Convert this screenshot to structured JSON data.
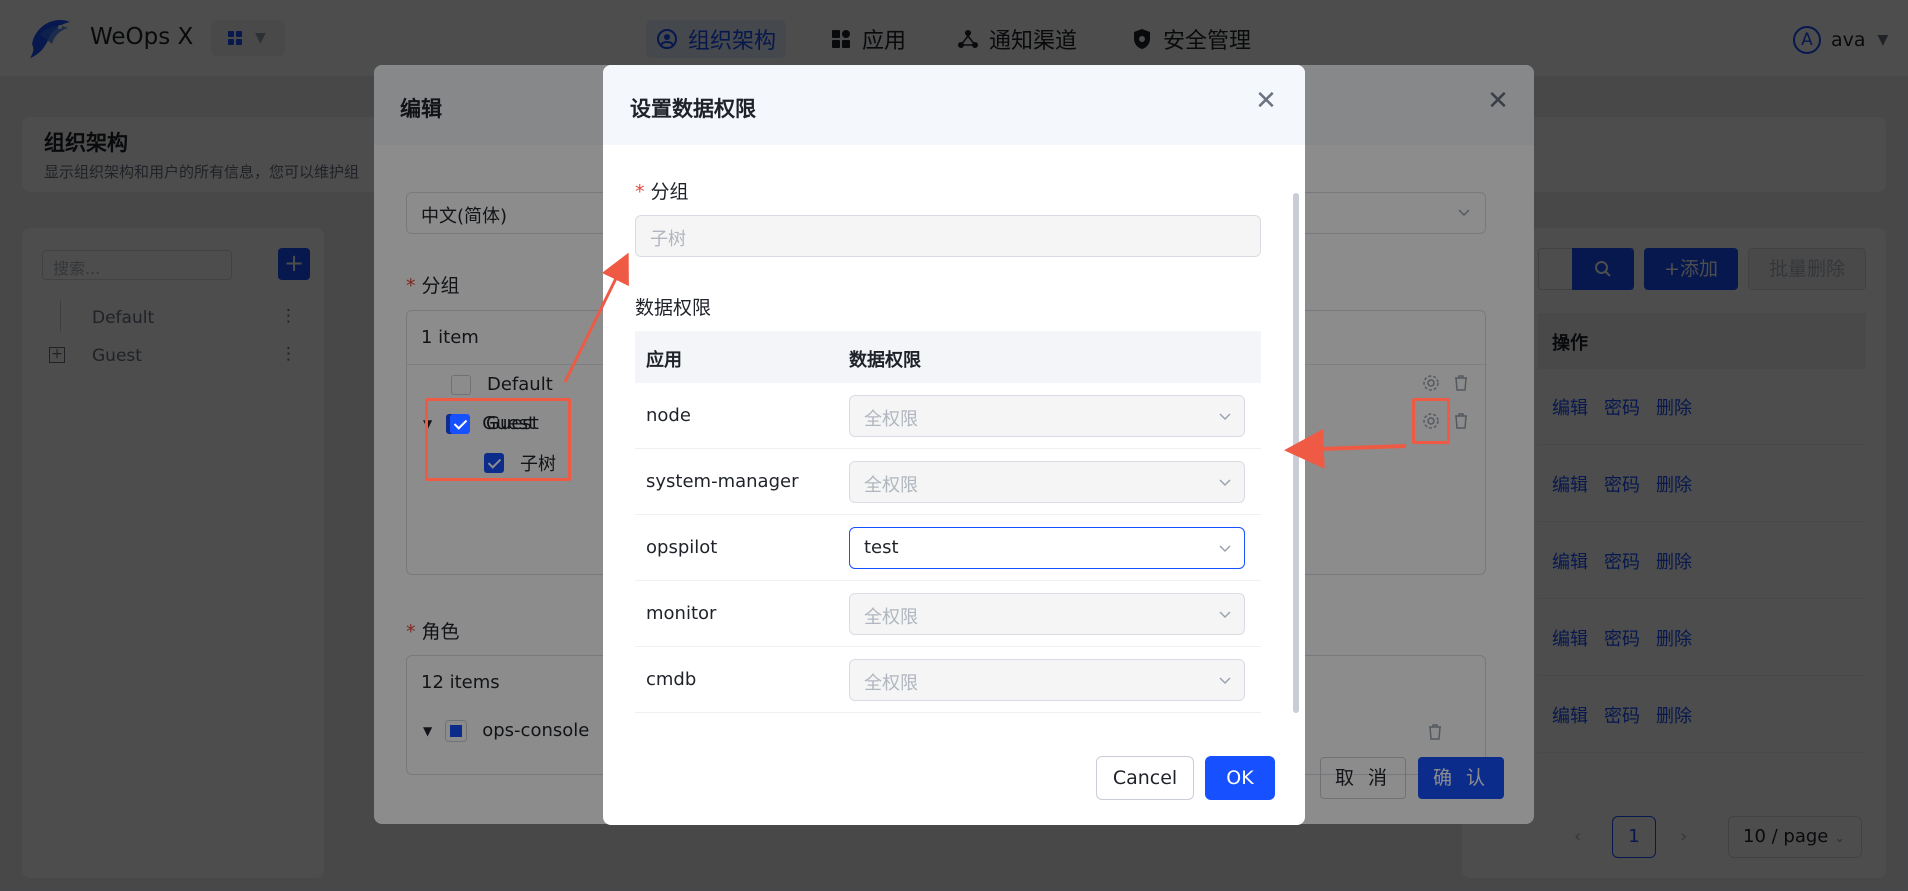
{
  "app": {
    "brand": "WeOps X"
  },
  "nav": {
    "items": [
      {
        "label": "组织架构",
        "icon": "user-circle-icon"
      },
      {
        "label": "应用",
        "icon": "apps-icon"
      },
      {
        "label": "通知渠道",
        "icon": "share-icon"
      },
      {
        "label": "安全管理",
        "icon": "shield-gear-icon"
      }
    ],
    "active": "组织架构"
  },
  "user": {
    "avatar_letter": "A",
    "name": "ava"
  },
  "page": {
    "title": "组织架构",
    "description": "显示组织架构和用户的所有信息，您可以维护组"
  },
  "left_panel": {
    "search_placeholder": "搜索...",
    "add_label": "+",
    "tree": [
      {
        "label": "Default"
      },
      {
        "label": "Guest"
      }
    ]
  },
  "right_panel": {
    "add_label": "+添加",
    "batch_delete_label": "批量删除",
    "column_header": "操作",
    "row_actions": [
      "编辑",
      "密码",
      "删除"
    ],
    "row_count": 5,
    "current_page": "1",
    "page_size": "10 / page"
  },
  "edit_modal": {
    "title": "编辑",
    "language_value": "中文(简体)",
    "group_label": "分组",
    "group_count": "1 item",
    "group_tree": [
      {
        "label": "Default",
        "checked": false
      },
      {
        "label": "Guest",
        "checked": true
      },
      {
        "label": "子树",
        "checked": true
      }
    ],
    "role_label": "角色",
    "role_count": "12 items",
    "role_first": "ops-console",
    "cancel_label": "取 消",
    "confirm_label": "确 认"
  },
  "perm_modal": {
    "title": "设置数据权限",
    "group_label": "分组",
    "group_placeholder": "子树",
    "section_label": "数据权限",
    "columns": {
      "app": "应用",
      "permission": "数据权限"
    },
    "rows": [
      {
        "app": "node",
        "permission": "全权限",
        "active": false
      },
      {
        "app": "system-manager",
        "permission": "全权限",
        "active": false
      },
      {
        "app": "opspilot",
        "permission": "test",
        "active": true
      },
      {
        "app": "monitor",
        "permission": "全权限",
        "active": false
      },
      {
        "app": "cmdb",
        "permission": "全权限",
        "active": false
      }
    ],
    "cancel_label": "Cancel",
    "ok_label": "OK"
  },
  "colors": {
    "primary": "#1650ff",
    "annotation": "#ef5a45",
    "danger_asterisk": "#e5483c"
  }
}
